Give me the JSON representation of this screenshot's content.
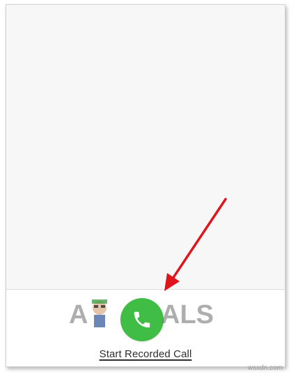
{
  "bottom_bar": {
    "call_button_icon": "phone-icon",
    "start_call_label": "Start Recorded Call"
  },
  "annotation": {
    "arrow_color": "#e0151b"
  },
  "watermark": {
    "logo_text": "APPUALS",
    "site_text": "wsxdn.com"
  },
  "colors": {
    "call_button": "#3fbd45",
    "background": "#f7f7f7"
  }
}
